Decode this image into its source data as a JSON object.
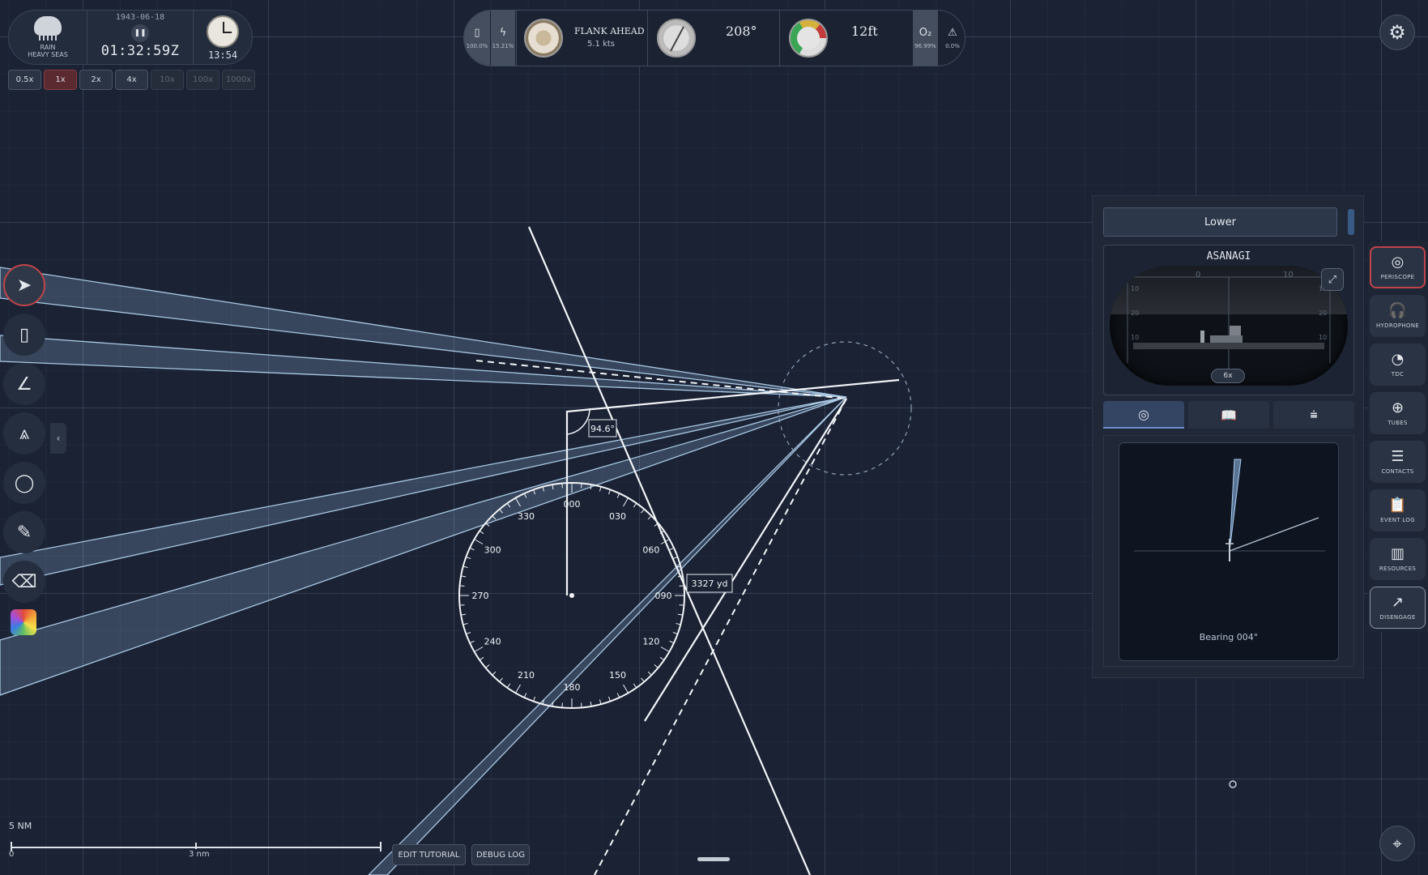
{
  "weather": {
    "line1": "RAIN",
    "line2": "HEAVY SEAS",
    "icon": "rain-cloud-icon"
  },
  "time": {
    "date": "1943-06-18",
    "clock": "01:32:59Z",
    "local": "13:54"
  },
  "speeds": [
    {
      "label": "0.5x",
      "state": "normal"
    },
    {
      "label": "1x",
      "state": "active"
    },
    {
      "label": "2x",
      "state": "normal"
    },
    {
      "label": "4x",
      "state": "normal"
    },
    {
      "label": "10x",
      "state": "disabled"
    },
    {
      "label": "100x",
      "state": "disabled"
    },
    {
      "label": "1000x",
      "state": "disabled"
    }
  ],
  "status": {
    "battery_pct": "100.0%",
    "charge_pct": "15.21%",
    "order": "FLANK AHEAD",
    "speed": "5.1 kts",
    "heading": "208°",
    "depth": "12ft",
    "oxygen_label": "O₂",
    "oxygen_pct": "96.99%",
    "alarm_pct": "0.0%"
  },
  "left_tools": [
    {
      "name": "select-tool",
      "icon": "cursor-icon",
      "glyph": "➤"
    },
    {
      "name": "ruler-tool",
      "icon": "ruler-icon",
      "glyph": "▯"
    },
    {
      "name": "protractor-tool",
      "icon": "angle-icon",
      "glyph": "∠"
    },
    {
      "name": "compass-tool",
      "icon": "compass-drafting-icon",
      "glyph": "⩓"
    },
    {
      "name": "circle-tool",
      "icon": "circle-icon",
      "glyph": "◯"
    },
    {
      "name": "pencil-tool",
      "icon": "pencil-icon",
      "glyph": "✎"
    },
    {
      "name": "eraser-tool",
      "icon": "eraser-icon",
      "glyph": "⌫"
    }
  ],
  "map": {
    "angle_label": "94.6°",
    "range_label": "3327 yd",
    "dial_labels": [
      "000",
      "030",
      "060",
      "090",
      "120",
      "150",
      "180",
      "210",
      "240",
      "270",
      "300",
      "330"
    ]
  },
  "scope": {
    "lower_label": "Lower",
    "target_name": "ASANAGI",
    "zoom": "6x",
    "reticle_top": [
      "0",
      "10"
    ],
    "reticle_left": [
      "10",
      "20",
      "10"
    ],
    "reticle_right": [
      "10",
      "20",
      "10"
    ],
    "bearing": "Bearing 004°",
    "tabs": [
      {
        "name": "tab-target",
        "icon": "target-icon",
        "glyph": "◎",
        "active": true
      },
      {
        "name": "tab-book",
        "icon": "book-icon",
        "glyph": "📖",
        "active": false
      },
      {
        "name": "tab-stadimeter",
        "icon": "stadimeter-icon",
        "glyph": "⩧",
        "active": false
      }
    ]
  },
  "stations": [
    {
      "label": "PERISCOPE",
      "icon": "periscope-icon",
      "glyph": "◎",
      "state": "active"
    },
    {
      "label": "HYDROPHONE",
      "icon": "headphones-icon",
      "glyph": "🎧",
      "state": "normal"
    },
    {
      "label": "TDC",
      "icon": "tdc-dial-icon",
      "glyph": "◔",
      "state": "normal"
    },
    {
      "label": "TUBES",
      "icon": "crosshair-icon",
      "glyph": "⊕",
      "state": "normal"
    },
    {
      "label": "CONTACTS",
      "icon": "list-icon",
      "glyph": "☰",
      "state": "normal"
    },
    {
      "label": "EVENT LOG",
      "icon": "clipboard-icon",
      "glyph": "📋",
      "state": "normal"
    },
    {
      "label": "RESOURCES",
      "icon": "resources-icon",
      "glyph": "▥",
      "state": "normal"
    },
    {
      "label": "DISENGAGE",
      "icon": "disengage-icon",
      "glyph": "↗",
      "state": "outlined"
    }
  ],
  "scale": {
    "label": "5 NM",
    "tick0": "0",
    "tick1": "3 nm"
  },
  "bottom_buttons": {
    "tutorial": "EDIT TUTORIAL",
    "debug": "DEBUG LOG"
  }
}
